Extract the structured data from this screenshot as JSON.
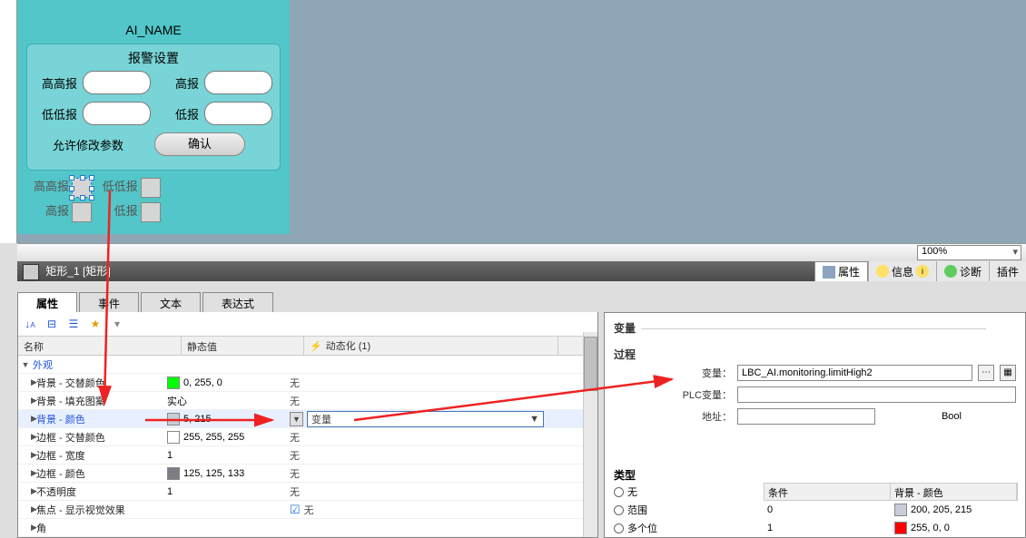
{
  "hmi": {
    "name": "AI_NAME",
    "alarm_title": "报警设置",
    "labels": {
      "high_high": "高高报",
      "high": "高报",
      "low_low": "低低报",
      "low": "低报"
    },
    "allow_edit": "允许修改参数",
    "confirm": "确认"
  },
  "zoom": "100%",
  "object_title": "矩形_1 [矩形]",
  "side_tabs": {
    "props": "属性",
    "info": "信息",
    "diag": "诊断",
    "plugin": "插件"
  },
  "sub_tabs": {
    "props": "属性",
    "events": "事件",
    "text": "文本",
    "expr": "表达式"
  },
  "table_headers": {
    "name": "名称",
    "static": "静态值",
    "dynamic": "动态化 (1)"
  },
  "tree_root": "外观",
  "rows": [
    {
      "name": "背景 - 交替颜色",
      "swatch": "#00ff00",
      "val": "0, 255, 0",
      "dyn": "无"
    },
    {
      "name": "背景 - 填充图案",
      "val": "实心",
      "dyn": "无"
    },
    {
      "name": "背景 - 颜色",
      "swatch": "#c8cdd7",
      "val": "5, 215",
      "dyn": "变量",
      "active": true
    },
    {
      "name": "边框 - 交替颜色",
      "swatch": "#ffffff",
      "val": "255, 255, 255",
      "dyn": "无"
    },
    {
      "name": "边框 - 宽度",
      "val": "1",
      "dyn": "无"
    },
    {
      "name": "边框 - 颜色",
      "swatch": "#7d7d85",
      "val": "125, 125, 133",
      "dyn": "无"
    },
    {
      "name": "不透明度",
      "val": "1",
      "dyn": "无"
    },
    {
      "name": "焦点 - 显示视觉效果",
      "val": "",
      "dyn": "无",
      "check": true
    },
    {
      "name": "角",
      "val": "",
      "dyn": ""
    }
  ],
  "variable": {
    "title": "变量",
    "process": "过程",
    "labels": {
      "var": "变量：",
      "plc_var": "PLC变量：",
      "addr": "地址："
    },
    "var_value": "LBC_AI.monitoring.limitHigh2",
    "addr_type": "Bool",
    "type_title": "类型",
    "type_options": {
      "none": "无",
      "range": "范围",
      "multi": "多个位"
    }
  },
  "cond": {
    "headers": {
      "c": "条件",
      "bg": "背景 - 颜色"
    },
    "rows": [
      {
        "cond": "0",
        "swatch": "#c8cdd7",
        "val": "200, 205, 215"
      },
      {
        "cond": "1",
        "swatch": "#ff0000",
        "val": "255, 0, 0"
      }
    ]
  }
}
